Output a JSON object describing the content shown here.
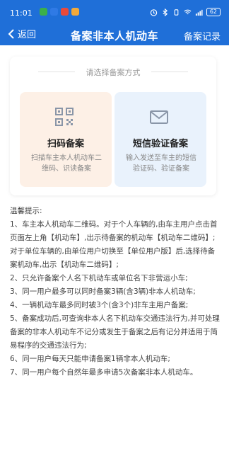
{
  "status": {
    "time": "11:01",
    "battery": "62",
    "app_colors": [
      "#3bb04a",
      "#2f7ae5",
      "#e94a3b",
      "#f2a93b"
    ]
  },
  "nav": {
    "back_label": "返回",
    "title": "备案非本人机动车",
    "records_label": "备案记录"
  },
  "choose": {
    "title": "请选择备案方式",
    "options": [
      {
        "name": "扫码备案",
        "desc": "扫描车主本人机动车二维码、识读备案",
        "icon": "qr-code-icon"
      },
      {
        "name": "短信验证备案",
        "desc": "输入发送至车主的短信验证码、验证备案",
        "icon": "envelope-icon"
      }
    ]
  },
  "tips": {
    "heading": "温馨提示:",
    "items": [
      "1、车主本人机动车二维码。对于个人车辆的,由车主用户点击首页面左上角【机动车】,出示待备案的机动车【机动车二维码】;对于单位车辆的,由单位用户切换至【单位用户版】后,选择待备案机动车,出示【机动车二维码】;",
      "2、只允许备案个人名下机动车或单位名下非营运小车;",
      "3、同一用户最多可以同时备案3辆(含3辆)非本人机动车;",
      "4、一辆机动车最多同时被3个(含3个)非车主用户备案;",
      "5、备案成功后,可查询非本人名下机动车交通违法行为,并可处理备案的非本人机动车不记分或发生于备案之后有记分并适用于简易程序的交通违法行为;",
      "6、同一用户每天只能申请备案1辆非本人机动车;",
      "7、同一用户每个自然年最多申请5次备案非本人机动车。"
    ]
  }
}
